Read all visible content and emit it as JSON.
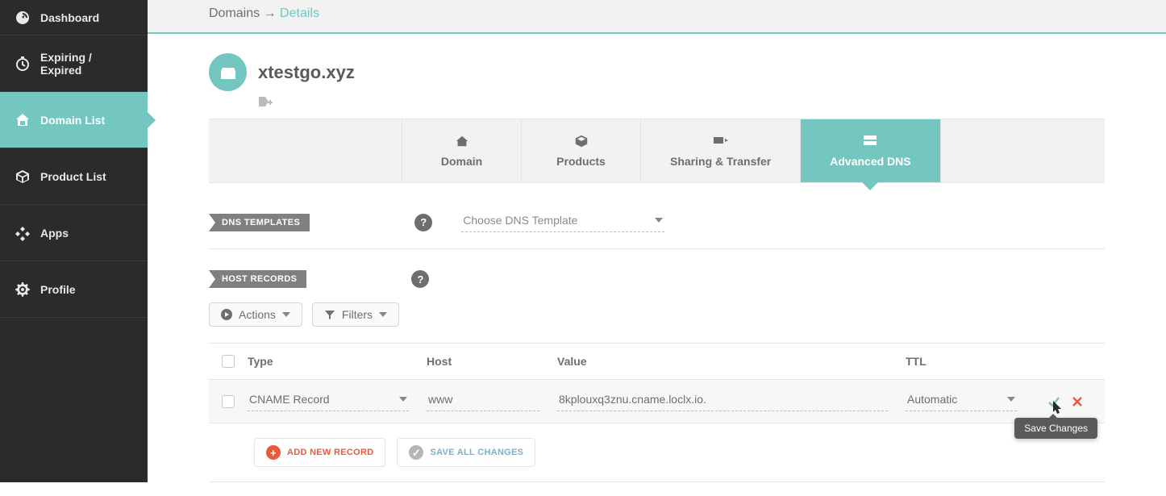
{
  "breadcrumb": {
    "root": "Domains",
    "arrow": "→",
    "leaf": "Details"
  },
  "sidebar": {
    "items": [
      {
        "label": "Dashboard"
      },
      {
        "label": "Expiring / Expired"
      },
      {
        "label": "Domain List"
      },
      {
        "label": "Product List"
      },
      {
        "label": "Apps"
      },
      {
        "label": "Profile"
      }
    ]
  },
  "domain": {
    "name": "xtestgo.xyz"
  },
  "tabs": [
    {
      "label": "Domain"
    },
    {
      "label": "Products"
    },
    {
      "label": "Sharing & Transfer"
    },
    {
      "label": "Advanced DNS"
    }
  ],
  "sections": {
    "dns_templates": "DNS TEMPLATES",
    "host_records": "HOST RECORDS",
    "template_placeholder": "Choose DNS Template",
    "help": "?"
  },
  "buttons": {
    "actions": "Actions",
    "filters": "Filters",
    "add_new_record": "ADD NEW RECORD",
    "save_all_changes": "SAVE ALL CHANGES"
  },
  "table": {
    "headers": {
      "type": "Type",
      "host": "Host",
      "value": "Value",
      "ttl": "TTL"
    },
    "rows": [
      {
        "type": "CNAME Record",
        "host": "www",
        "value": "8kplouxq3znu.cname.loclx.io.",
        "ttl": "Automatic"
      }
    ]
  },
  "tooltip": {
    "save_changes": "Save Changes"
  }
}
